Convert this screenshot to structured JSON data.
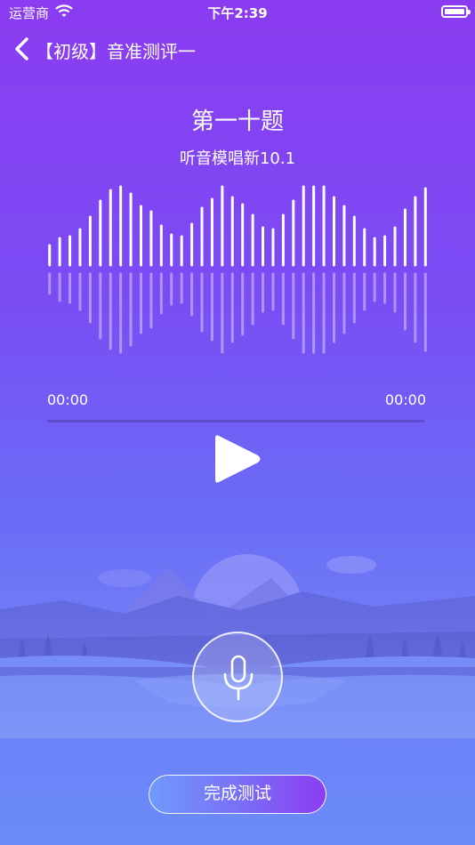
{
  "status_bar": {
    "carrier": "运营商",
    "time": "下午2:39"
  },
  "nav": {
    "title": "【初级】音准测评一"
  },
  "question": {
    "title": "第一十题",
    "subtitle": "听音模唱新10.1"
  },
  "player": {
    "elapsed": "00:00",
    "duration": "00:00",
    "progress": 0
  },
  "waveform": {
    "bars": [
      22,
      30,
      32,
      40,
      54,
      72,
      84,
      88,
      80,
      66,
      60,
      44,
      34,
      32,
      46,
      64,
      74,
      88,
      76,
      68,
      56,
      42,
      40,
      56,
      72,
      88,
      88,
      88,
      76,
      66,
      54,
      40,
      30,
      32,
      42,
      62,
      76,
      86
    ]
  },
  "actions": {
    "finish_label": "完成测试"
  },
  "colors": {
    "accent_top": "#8b3cf0",
    "accent_bottom": "#6b8cf8"
  }
}
